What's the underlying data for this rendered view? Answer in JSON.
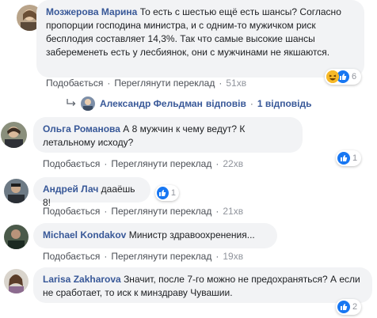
{
  "actions": {
    "like": "Подобається",
    "translate": "Переглянути переклад",
    "sep": "·"
  },
  "colors": {
    "link": "#385898",
    "bubble": "#f2f3f5",
    "like": "#1877f2",
    "haha": "#f7b928"
  },
  "comments": [
    {
      "author": "Мозжерова Марина",
      "text": "То есть с шестью ещё есть шансы? Согласно пропорции господина министра, и с одним-то мужичком риск бесплодия составляет 14,3%. Так что самые высокие шансы забеременеть есть у лесбиянок, они с мужчинами не якшаются.",
      "time": "51хв",
      "reactions": {
        "icons": [
          "haha-icon",
          "like-icon"
        ],
        "count": "6"
      },
      "reply_line": {
        "author": "Александр Фельдман",
        "verb": "відповів",
        "count_text": "1 відповідь"
      }
    },
    {
      "author": "Ольга Романова",
      "text": "А 8 мужчин к чему ведут? К летальному исходу?",
      "time": "22хв",
      "reactions": {
        "icons": [
          "like-icon"
        ],
        "count": "1"
      }
    },
    {
      "author": "Андрей Лач",
      "text": "дааёшь 8!",
      "time": "21хв",
      "reactions": {
        "icons": [
          "like-icon"
        ],
        "count": "1"
      }
    },
    {
      "author": "Michael Kondakov",
      "text": "Министр здравоохренения...",
      "time": "19хв"
    },
    {
      "author": "Larisa Zakharova",
      "text": "Значит, после 7-го можно не предохраняться? А если не сработает, то иск к минздраву Чувашии.",
      "time": "",
      "reactions": {
        "icons": [
          "like-icon"
        ],
        "count": "2"
      }
    }
  ]
}
